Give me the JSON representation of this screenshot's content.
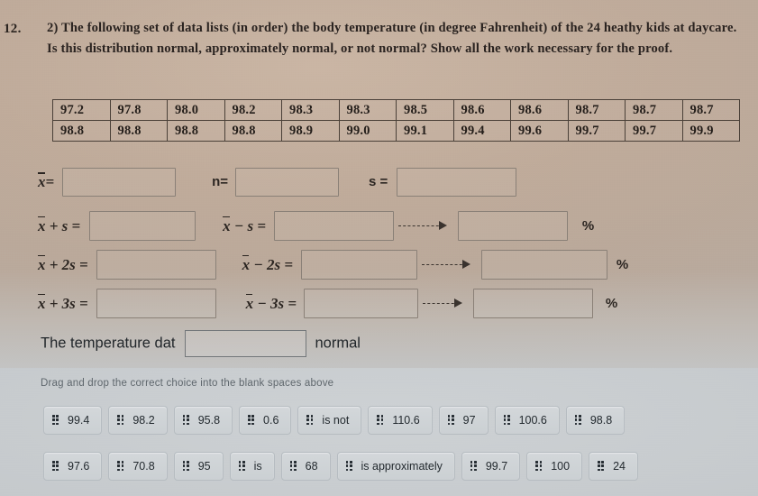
{
  "question": {
    "number": "12.",
    "text": "2) The following set of data lists (in order) the body temperature (in degree Fahrenheit) of the 24 heathy kids at daycare. Is this distribution normal, approximately normal, or not normal? Show all the work necessary for the proof."
  },
  "data_table": {
    "rows": [
      [
        "97.2",
        "97.8",
        "98.0",
        "98.2",
        "98.3",
        "98.3",
        "98.5",
        "98.6",
        "98.6",
        "98.7",
        "98.7",
        "98.7"
      ],
      [
        "98.8",
        "98.8",
        "98.8",
        "98.8",
        "98.9",
        "99.0",
        "99.1",
        "99.4",
        "99.6",
        "99.7",
        "99.7",
        "99.9"
      ]
    ]
  },
  "stats_row": {
    "mean_label": "x",
    "mean_eq": "=",
    "n_label": "n=",
    "s_label": "s =",
    "mean_value": "",
    "n_value": "",
    "s_value": ""
  },
  "interval_rows": [
    {
      "plus_label_prefix": "x",
      "plus_label_suffix": " + s =",
      "minus_label_prefix": "x",
      "minus_label_suffix": " − s =",
      "plus_value": "",
      "minus_value": "",
      "percent_value": "",
      "percent_sign": "%"
    },
    {
      "plus_label_prefix": "x",
      "plus_label_suffix": " + 2s =",
      "minus_label_prefix": "x",
      "minus_label_suffix": " − 2s =",
      "plus_value": "",
      "minus_value": "",
      "percent_value": "",
      "percent_sign": "%"
    },
    {
      "plus_label_prefix": "x",
      "plus_label_suffix": " + 3s =",
      "minus_label_prefix": "x",
      "minus_label_suffix": " − 3s =",
      "plus_value": "",
      "minus_value": "",
      "percent_value": "",
      "percent_sign": "%"
    }
  ],
  "conclusion": {
    "lead_text": "The temperature dat",
    "blank_value": "",
    "trail_text": "normal"
  },
  "drag_drop": {
    "hint": "Drag and drop the correct choice into the blank spaces above",
    "handle_icon": "drag-handle-icon",
    "rows": [
      [
        "99.4",
        "98.2",
        "95.8",
        "0.6",
        "is not",
        "110.6",
        "97",
        "100.6",
        "98.8"
      ],
      [
        "97.6",
        "70.8",
        "95",
        "is",
        "68",
        "is approximately",
        "99.7",
        "100",
        "24"
      ]
    ]
  },
  "colors": {
    "paper": "#c5b09e",
    "grey_panel": "#c8cccf",
    "tile_face": "#d0d5d8",
    "tile_border": "#b6bcc1",
    "ink": "#2a2320",
    "hint_text": "#5f676d"
  }
}
